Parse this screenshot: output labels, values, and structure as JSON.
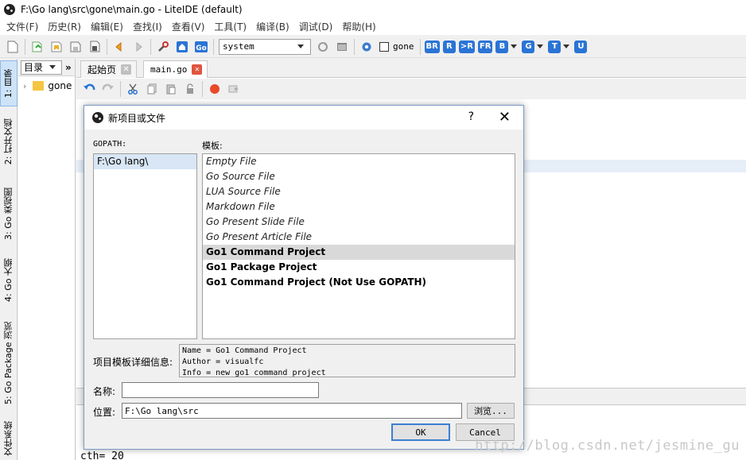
{
  "window": {
    "title": "F:\\Go lang\\src\\gone\\main.go - LiteIDE (default)"
  },
  "menu": [
    "文件(F)",
    "历史(R)",
    "编辑(E)",
    "查找(I)",
    "查看(V)",
    "工具(T)",
    "编译(B)",
    "调试(D)",
    "帮助(H)"
  ],
  "toolbar": {
    "env_combo": "system",
    "gone_check_label": "gone",
    "build_buttons": [
      "BR",
      "R",
      ">R",
      "FR",
      "B",
      "G",
      "T",
      "U"
    ]
  },
  "sidetabs": [
    "1: 目录",
    "2: 打开文档",
    "3: Go 类视图",
    "4: Go 大纲",
    "5: Go Package 浏览",
    "文件系统"
  ],
  "dirpanel": {
    "combo": "目录",
    "more": "»",
    "tree_item": "gone"
  },
  "editor": {
    "tabs": [
      {
        "label": "起始页"
      },
      {
        "label": "main.go"
      }
    ],
    "code_fragment": "cth= 20"
  },
  "dialog": {
    "title": "新项目或文件",
    "help": "?",
    "close": "✕",
    "gopath_label": "GOPATH:",
    "gopath_items": [
      "F:\\Go lang\\"
    ],
    "templates_label": "模板:",
    "templates": [
      {
        "label": "Empty File",
        "style": "italic"
      },
      {
        "label": "Go Source File",
        "style": "italic"
      },
      {
        "label": "LUA Source File",
        "style": "italic"
      },
      {
        "label": "Markdown File",
        "style": "italic"
      },
      {
        "label": "Go Present Slide File",
        "style": "italic"
      },
      {
        "label": "Go Present Article File",
        "style": "italic"
      },
      {
        "label": "Go1 Command Project",
        "style": "bold",
        "selected": true
      },
      {
        "label": "Go1 Package Project",
        "style": "bold"
      },
      {
        "label": "Go1 Command Project (Not Use GOPATH)",
        "style": "bold"
      }
    ],
    "details_label": "项目模板详细信息:",
    "details": [
      "Name = Go1 Command Project",
      "Author = visualfc",
      "Info = new go1 command project"
    ],
    "name_label": "名称:",
    "name_value": "",
    "location_label": "位置:",
    "location_value": "F:\\Go lang\\src",
    "browse_button": "浏览...",
    "ok_button": "OK",
    "cancel_button": "Cancel"
  },
  "watermark": "http://blog.csdn.net/jesmine_gu",
  "colors": {
    "accent": "#2a74d6",
    "selection": "#d8e6f5",
    "close_red": "#e0553f"
  }
}
